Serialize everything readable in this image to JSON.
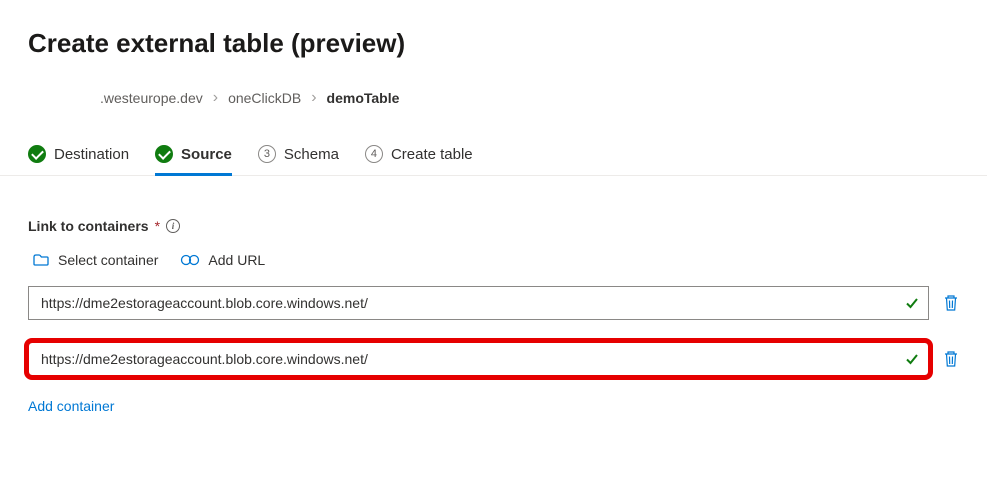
{
  "page": {
    "title": "Create external table (preview)"
  },
  "breadcrumb": {
    "items": [
      {
        "label": ".westeurope.dev"
      },
      {
        "label": "oneClickDB"
      },
      {
        "label": "demoTable",
        "current": true
      }
    ]
  },
  "steps": [
    {
      "label": "Destination",
      "done": true,
      "active": false,
      "num": ""
    },
    {
      "label": "Source",
      "done": true,
      "active": true,
      "num": ""
    },
    {
      "label": "Schema",
      "done": false,
      "active": false,
      "num": "3"
    },
    {
      "label": "Create table",
      "done": false,
      "active": false,
      "num": "4"
    }
  ],
  "section": {
    "label": "Link to containers",
    "required": "*",
    "info_tooltip": "i"
  },
  "toolbar": {
    "select_container": "Select container",
    "add_url": "Add URL"
  },
  "urls": [
    {
      "value": "https://dme2estorageaccount.blob.core.windows.net/",
      "highlight": false
    },
    {
      "value": "https://dme2estorageaccount.blob.core.windows.net/",
      "highlight": true
    }
  ],
  "actions": {
    "add_container": "Add container"
  },
  "colors": {
    "primary_blue": "#0078d4",
    "success_green": "#107c10",
    "error_red": "#e60000"
  }
}
